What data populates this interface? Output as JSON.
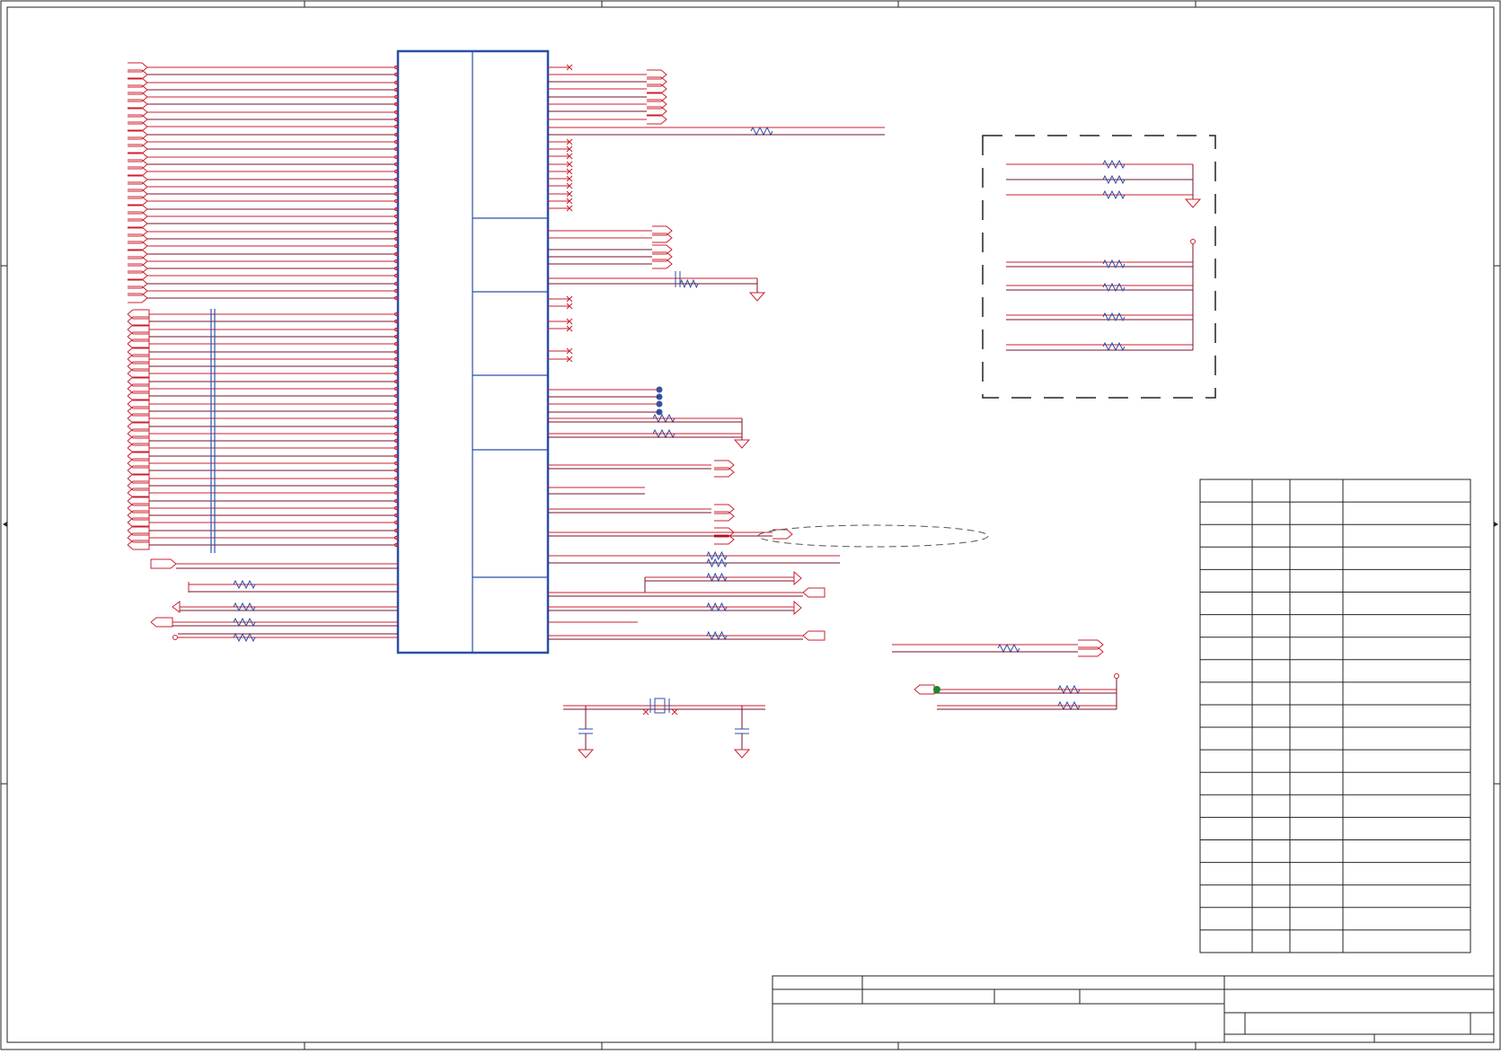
{
  "sheet": {
    "title": "",
    "border_labels": [],
    "title_block": {
      "rows": []
    }
  },
  "table": {
    "headers": [
      "",
      "",
      "",
      ""
    ],
    "rows": []
  },
  "colors": {
    "wire": "#cc1f2f",
    "wire_dark": "#7a1028",
    "component": "#2b4fa8",
    "frame": "#222222",
    "junction_blue": "#2e56a6",
    "junction_green": "#1a8a2a",
    "dashed_box": "#222222"
  }
}
